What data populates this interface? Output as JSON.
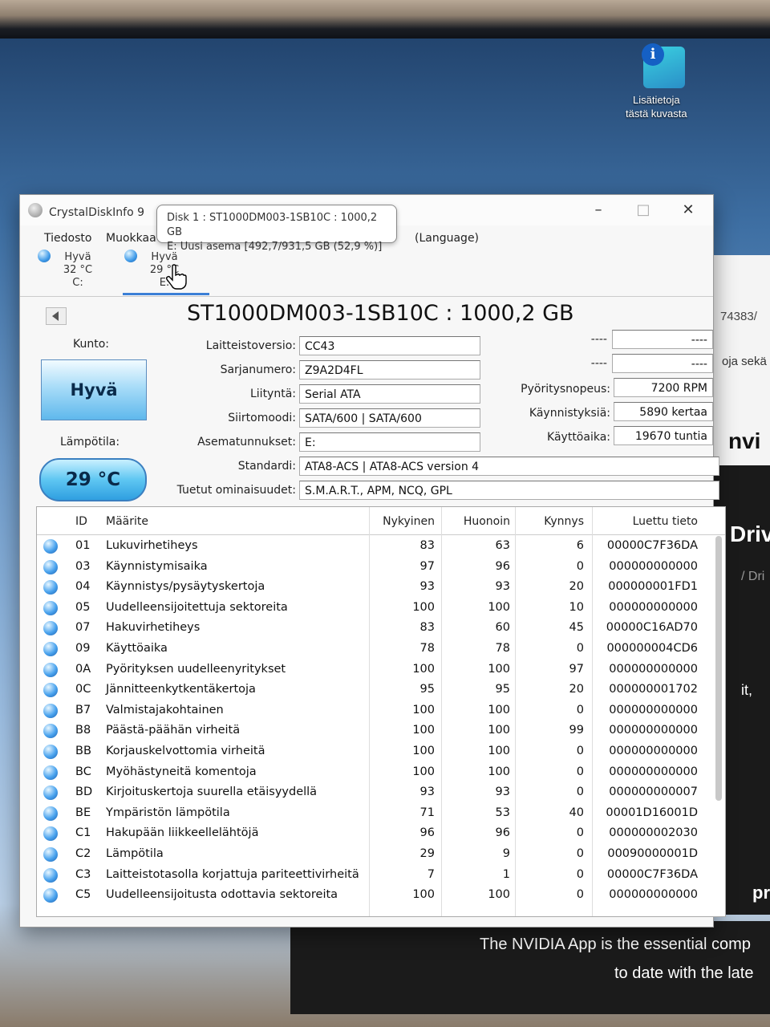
{
  "desktop": {
    "icon_label_line1": "Lisätietoja",
    "icon_label_line2": "tästä kuvasta"
  },
  "background_window": {
    "fragment1": "74383/",
    "fragment2": "oja sekä",
    "fragment3": "nvi",
    "fragment4": "Driv",
    "fragment5": "/ Dri",
    "fragment6": "it,",
    "fragment7": "pr",
    "banner_line1": "The NVIDIA App is the essential comp",
    "banner_line2": "to date with the late"
  },
  "window": {
    "title": "CrystalDiskInfo 9",
    "menu": [
      "Tiedosto",
      "Muokkaa",
      "(Language)"
    ],
    "drives": [
      {
        "status": "Hyvä",
        "temp": "32 °C",
        "letter": "C:"
      },
      {
        "status": "Hyvä",
        "temp": "29 °C",
        "letter": "E:"
      }
    ],
    "tooltip_line1": "Disk 1 : ST1000DM003-1SB10C : 1000,2 GB",
    "tooltip_line2": "E: Uusi asema [492,7/931,5 GB (52,9 %)]"
  },
  "disk": {
    "title": "ST1000DM003-1SB10C : 1000,2 GB",
    "health_label": "Kunto:",
    "health_value": "Hyvä",
    "temp_label": "Lämpötila:",
    "temp_value": "29 °C",
    "firmware_label": "Laitteistoversio:",
    "firmware": "CC43",
    "serial_label": "Sarjanumero:",
    "serial": "Z9A2D4FL",
    "interface_label": "Liityntä:",
    "interface": "Serial ATA",
    "transfer_label": "Siirtomoodi:",
    "transfer": "SATA/600 | SATA/600",
    "drive_letter_label": "Asematunnukset:",
    "drive_letter": "E:",
    "standard_label": "Standardi:",
    "standard": "ATA8-ACS | ATA8-ACS version 4",
    "features_label": "Tuetut ominaisuudet:",
    "features": "S.M.A.R.T., APM, NCQ, GPL",
    "dash_label1": "----",
    "dash_value1": "----",
    "dash_label2": "----",
    "dash_value2": "----",
    "rotation_label": "Pyöritysnopeus:",
    "rotation": "7200 RPM",
    "power_on_count_label": "Käynnistyksiä:",
    "power_on_count": "5890 kertaa",
    "power_on_hours_label": "Käyttöaika:",
    "power_on_hours": "19670 tuntia"
  },
  "smart": {
    "headers": {
      "id": "ID",
      "attr": "Määrite",
      "current": "Nykyinen",
      "worst": "Huonoin",
      "threshold": "Kynnys",
      "raw": "Luettu tieto"
    },
    "rows": [
      {
        "id": "01",
        "attr": "Lukuvirhetiheys",
        "current": "83",
        "worst": "63",
        "threshold": "6",
        "raw": "00000C7F36DA"
      },
      {
        "id": "03",
        "attr": "Käynnistymisaika",
        "current": "97",
        "worst": "96",
        "threshold": "0",
        "raw": "000000000000"
      },
      {
        "id": "04",
        "attr": "Käynnistys/pysäytyskertoja",
        "current": "93",
        "worst": "93",
        "threshold": "20",
        "raw": "000000001FD1"
      },
      {
        "id": "05",
        "attr": "Uudelleensijoitettuja sektoreita",
        "current": "100",
        "worst": "100",
        "threshold": "10",
        "raw": "000000000000"
      },
      {
        "id": "07",
        "attr": "Hakuvirhetiheys",
        "current": "83",
        "worst": "60",
        "threshold": "45",
        "raw": "00000C16AD70"
      },
      {
        "id": "09",
        "attr": "Käyttöaika",
        "current": "78",
        "worst": "78",
        "threshold": "0",
        "raw": "000000004CD6"
      },
      {
        "id": "0A",
        "attr": "Pyörityksen uudelleenyritykset",
        "current": "100",
        "worst": "100",
        "threshold": "97",
        "raw": "000000000000"
      },
      {
        "id": "0C",
        "attr": "Jännitteenkytkentäkertoja",
        "current": "95",
        "worst": "95",
        "threshold": "20",
        "raw": "000000001702"
      },
      {
        "id": "B7",
        "attr": "Valmistajakohtainen",
        "current": "100",
        "worst": "100",
        "threshold": "0",
        "raw": "000000000000"
      },
      {
        "id": "B8",
        "attr": "Päästä-päähän virheitä",
        "current": "100",
        "worst": "100",
        "threshold": "99",
        "raw": "000000000000"
      },
      {
        "id": "BB",
        "attr": "Korjauskelvottomia virheitä",
        "current": "100",
        "worst": "100",
        "threshold": "0",
        "raw": "000000000000"
      },
      {
        "id": "BC",
        "attr": "Myöhästyneitä komentoja",
        "current": "100",
        "worst": "100",
        "threshold": "0",
        "raw": "000000000000"
      },
      {
        "id": "BD",
        "attr": "Kirjoituskertoja suurella etäisyydellä",
        "current": "93",
        "worst": "93",
        "threshold": "0",
        "raw": "000000000007"
      },
      {
        "id": "BE",
        "attr": "Ympäristön lämpötila",
        "current": "71",
        "worst": "53",
        "threshold": "40",
        "raw": "00001D16001D"
      },
      {
        "id": "C1",
        "attr": "Hakupään liikkeellelähtöjä",
        "current": "96",
        "worst": "96",
        "threshold": "0",
        "raw": "000000002030"
      },
      {
        "id": "C2",
        "attr": "Lämpötila",
        "current": "29",
        "worst": "9",
        "threshold": "0",
        "raw": "00090000001D"
      },
      {
        "id": "C3",
        "attr": "Laitteistotasolla korjattuja pariteettivirheitä",
        "current": "7",
        "worst": "1",
        "threshold": "0",
        "raw": "00000C7F36DA"
      },
      {
        "id": "C5",
        "attr": "Uudelleensijoitusta odottavia sektoreita",
        "current": "100",
        "worst": "100",
        "threshold": "0",
        "raw": "000000000000"
      }
    ]
  }
}
